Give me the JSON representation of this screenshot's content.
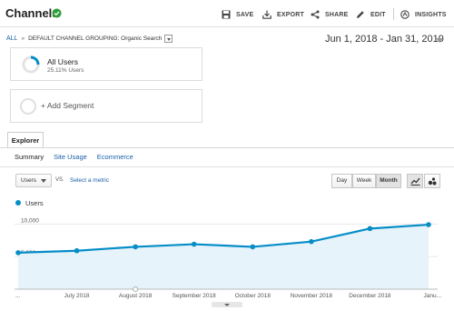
{
  "header": {
    "title": "Channels",
    "save": "SAVE",
    "export": "EXPORT",
    "share": "SHARE",
    "edit": "EDIT",
    "insights": "INSIGHTS"
  },
  "breadcrumb": {
    "all": "ALL",
    "separator": "»",
    "grouping": "DEFAULT CHANNEL GROUPING: Organic Search"
  },
  "date_range": "Jun 1, 2018 - Jan 31, 2019",
  "segments": {
    "active": {
      "name": "All Users",
      "percent": "25.11% Users",
      "fraction": 0.2511
    },
    "add_label": "+ Add Segment"
  },
  "tabs": {
    "explorer": "Explorer"
  },
  "subtabs": [
    "Summary",
    "Site Usage",
    "Ecommerce"
  ],
  "controls": {
    "metric": "Users",
    "vs": "VS.",
    "select_metric": "Select a metric",
    "periods": [
      "Day",
      "Week",
      "Month"
    ],
    "active_period": "Month"
  },
  "colors": {
    "series": "#058dc7",
    "fill": "#e6f3fa",
    "link": "#1a5faa"
  },
  "chart_data": {
    "type": "area",
    "series": [
      {
        "name": "Users",
        "values": [
          5600,
          5900,
          6500,
          6900,
          6500,
          7300,
          9300,
          9900
        ]
      }
    ],
    "x_labels": [
      "...",
      "July 2018",
      "August 2018",
      "September 2018",
      "October 2018",
      "November 2018",
      "December 2018",
      "Janu..."
    ],
    "y_ticks": [
      "10,000",
      "5,000"
    ],
    "ylim": [
      0,
      12000
    ],
    "legend_placement": "top-left",
    "grid": true
  }
}
